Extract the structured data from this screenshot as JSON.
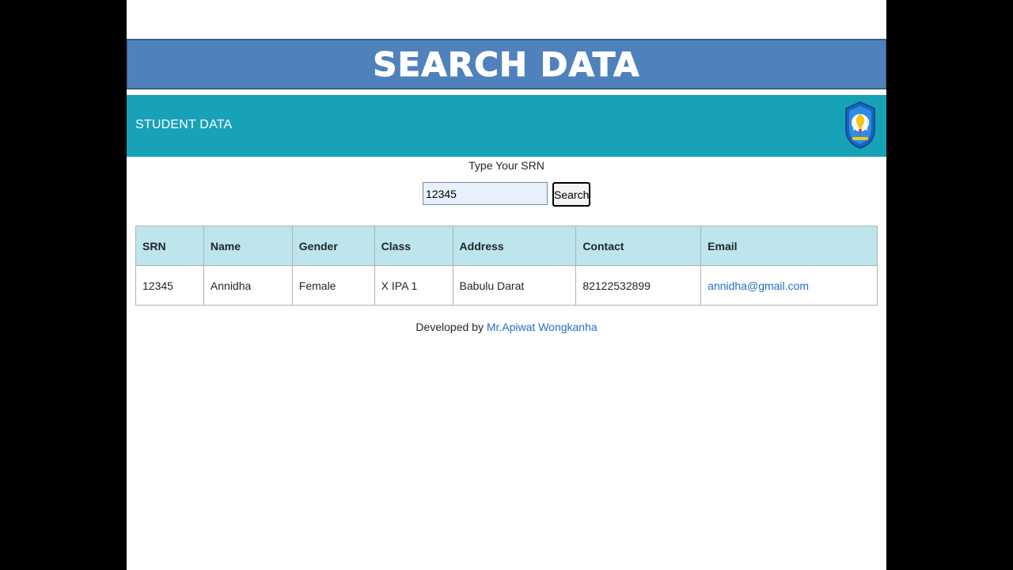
{
  "banner": {
    "title": "SEARCH DATA"
  },
  "navbar": {
    "brand": "STUDENT DATA",
    "logo_icon": "tut-wuri-handayani-emblem-icon",
    "bg_color": "#17a2b8"
  },
  "search": {
    "prompt": "Type Your SRN",
    "input_value": "12345",
    "button_label": "Search"
  },
  "table": {
    "headers": {
      "srn": "SRN",
      "name": "Name",
      "gender": "Gender",
      "class": "Class",
      "address": "Address",
      "contact": "Contact",
      "email": "Email"
    },
    "rows": [
      {
        "srn": "12345",
        "name": "Annidha",
        "gender": "Female",
        "class": "X IPA 1",
        "address": "Babulu Darat",
        "contact": "82122532899",
        "email": "annidha@gmail.com"
      }
    ]
  },
  "footer": {
    "prefix": "Developed by",
    "author": "Mr.Apiwat Wongkanha"
  },
  "colors": {
    "banner": "#4f81bd",
    "header_row": "#bee5eb",
    "link": "#1f6fc5"
  }
}
